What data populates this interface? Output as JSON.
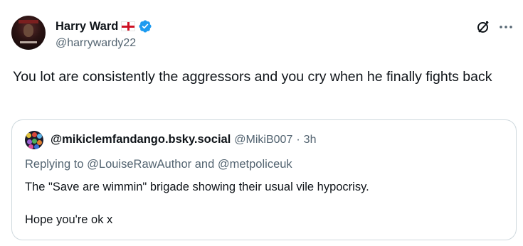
{
  "tweet": {
    "author": {
      "display_name": "Harry Ward",
      "flag": "england-flag",
      "verified": true,
      "handle": "@harrywardy22"
    },
    "text": "You lot are consistently the aggressors and you cry when he finally fights back"
  },
  "quote": {
    "author": {
      "display_name": "@mikiclemfandango.bsky.social",
      "handle": "@MikiB007",
      "separator": "·",
      "time": "3h"
    },
    "reply_prefix": "Replying to",
    "reply_to_1": "@LouiseRawAuthor",
    "reply_and": "and",
    "reply_to_2": "@metpoliceuk",
    "line1": "The \"Save are wimmin\" brigade showing their usual vile hypocrisy.",
    "line2": "Hope you're ok x"
  },
  "colors": {
    "text": "#0f1419",
    "secondary": "#536471",
    "verified": "#1d9bf0",
    "border": "#cfd9de",
    "flag_red": "#ce1124"
  },
  "icons": {
    "grok": "grok-icon",
    "more": "more-icon",
    "verified": "verified-badge-icon"
  }
}
